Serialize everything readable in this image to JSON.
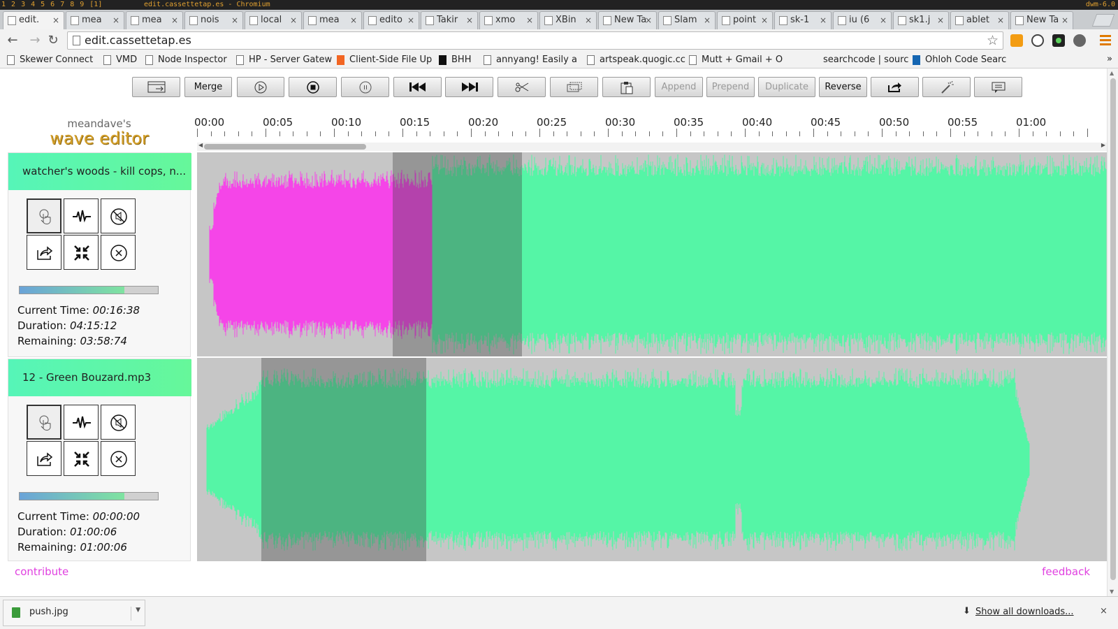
{
  "dwm": {
    "tags": [
      "1",
      "2",
      "3",
      "4",
      "5",
      "6",
      "7",
      "8",
      "9",
      "[1]"
    ],
    "window_title": "edit.cassettetap.es - Chromium",
    "version": "dwm-6.0"
  },
  "tabs": [
    {
      "label": "edit.",
      "active": true
    },
    {
      "label": "mea",
      "active": false
    },
    {
      "label": "mea",
      "active": false
    },
    {
      "label": "nois",
      "active": false
    },
    {
      "label": "local",
      "active": false
    },
    {
      "label": "mea",
      "active": false
    },
    {
      "label": "edito",
      "active": false
    },
    {
      "label": "Takir",
      "active": false
    },
    {
      "label": "xmo",
      "active": false
    },
    {
      "label": "XBin",
      "active": false
    },
    {
      "label": "New Ta",
      "active": false
    },
    {
      "label": "Slam",
      "active": false
    },
    {
      "label": "point",
      "active": false
    },
    {
      "label": "sk-1",
      "active": false
    },
    {
      "label": "iu (6",
      "active": false
    },
    {
      "label": "sk1.j",
      "active": false
    },
    {
      "label": "ablet",
      "active": false
    },
    {
      "label": "New Ta",
      "active": false
    }
  ],
  "omnibox": {
    "url": "edit.cassettetap.es"
  },
  "bookmarks": [
    "Skewer Connect",
    "VMD",
    "Node Inspector",
    "HP - Server Gatew",
    "Client-Side File Up",
    "BHH",
    "annyang! Easily a",
    "artspeak.quogic.cc",
    "Mutt + Gmail + O",
    "searchcode | sourc",
    "Ohloh Code Searc"
  ],
  "bookmarks_more": "»",
  "toolbar": {
    "merge": "Merge",
    "append": "Append",
    "prepend": "Prepend",
    "duplicate": "Duplicate",
    "reverse": "Reverse"
  },
  "brand": {
    "small": "meandave's",
    "big": "wave editor"
  },
  "tracks": [
    {
      "title": "watcher's woods - kill cops, n...",
      "current_time_label": "Current Time:",
      "current_time": "00:16:38",
      "duration_label": "Duration:",
      "duration": "04:15:12",
      "remaining_label": "Remaining:",
      "remaining": "03:58:74",
      "progress": 0.76
    },
    {
      "title": "12 - Green Bouzard.mp3",
      "current_time_label": "Current Time:",
      "current_time": "00:00:00",
      "duration_label": "Duration:",
      "duration": "01:00:06",
      "remaining_label": "Remaining:",
      "remaining": "01:00:06",
      "progress": 0.76
    }
  ],
  "timeline": {
    "labels": [
      "00:00",
      "00:05",
      "00:10",
      "00:15",
      "00:20",
      "00:25",
      "00:30",
      "00:35",
      "00:40",
      "00:45",
      "00:50",
      "00:55",
      "01:00"
    ]
  },
  "footer": {
    "contribute": "contribute",
    "feedback": "feedback"
  },
  "downloads": {
    "file": "push.jpg",
    "show_all": "Show all downloads...",
    "close": "×"
  },
  "colors": {
    "wave": "#55f5a6",
    "played": "#f545e8",
    "selection": "rgba(60,60,60,0.35)",
    "accent": "#e040e0"
  }
}
